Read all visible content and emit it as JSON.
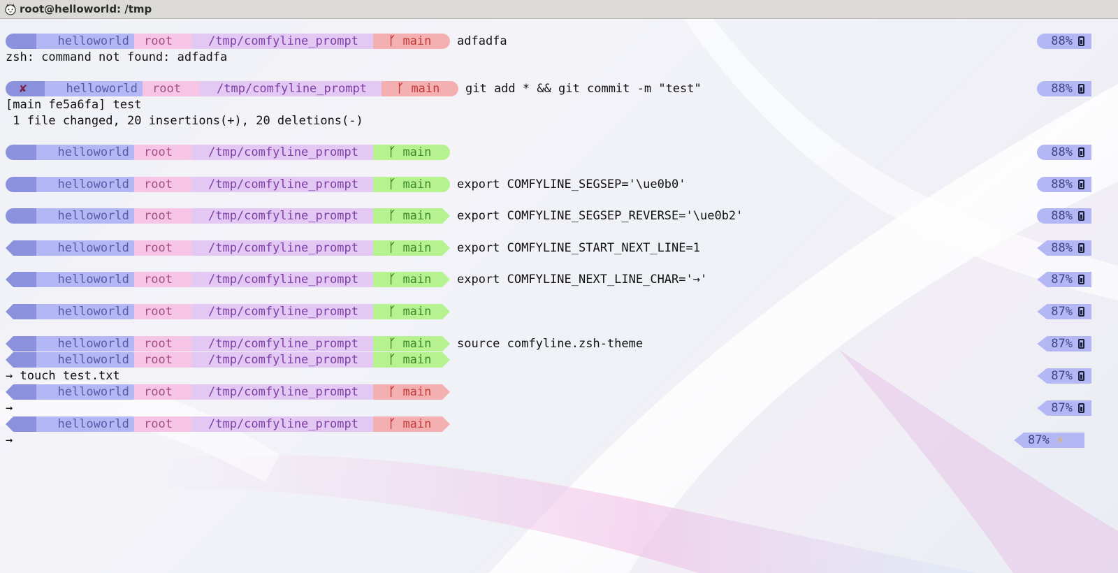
{
  "window": {
    "title": "root@helloworld: /tmp"
  },
  "prompt": {
    "host": "helloworld",
    "user": "root",
    "path": "/tmp/comfyline_prompt",
    "branch": "main",
    "error_mark": "✘",
    "branch_icon": "git-branch-icon"
  },
  "colors": {
    "status_bg": "#8b91dc",
    "host_bg": "#b3b8f4",
    "user_bg": "#f6c4e5",
    "path_bg": "#e2c8f2",
    "git_dirty_bg": "#f4b0b0",
    "git_clean_bg": "#b6f290",
    "battery_bg": "#b3b8f4"
  },
  "lines": [
    {
      "kind": "prompt",
      "style": "rounded",
      "git": "dirty",
      "cmd": "adfadfa",
      "batt": "88%",
      "power": "battery"
    },
    {
      "kind": "output",
      "text": "zsh: command not found: adfadfa"
    },
    {
      "kind": "prompt",
      "style": "rounded",
      "git": "dirty",
      "error": true,
      "cmd": "git add * && git commit -m \"test\"",
      "batt": "88%",
      "power": "battery"
    },
    {
      "kind": "output",
      "text": "[main fe5a6fa] test"
    },
    {
      "kind": "output",
      "text": " 1 file changed, 20 insertions(+), 20 deletions(-)"
    },
    {
      "kind": "prompt",
      "style": "rounded",
      "git": "clean",
      "cmd": "",
      "batt": "88%",
      "power": "battery"
    },
    {
      "kind": "prompt",
      "style": "rounded",
      "git": "clean",
      "cmd": "export COMFYLINE_SEGSEP='\\ue0b0'",
      "batt": "88%",
      "power": "battery"
    },
    {
      "kind": "prompt",
      "style": "rounded-arrow",
      "git": "clean",
      "cmd": "export COMFYLINE_SEGSEP_REVERSE='\\ue0b2'",
      "batt": "88%",
      "power": "battery"
    },
    {
      "kind": "prompt",
      "style": "arrow",
      "git": "clean",
      "cmd": "export COMFYLINE_START_NEXT_LINE=1",
      "batt": "88%",
      "power": "battery",
      "batt_arrow": true
    },
    {
      "kind": "prompt",
      "style": "arrow",
      "git": "clean",
      "cmd": "export COMFYLINE_NEXT_LINE_CHAR='→'",
      "batt": "87%",
      "power": "battery",
      "batt_arrow": true
    },
    {
      "kind": "prompt",
      "style": "arrow",
      "git": "clean",
      "cmd": "",
      "batt": "87%",
      "power": "battery",
      "batt_arrow": true
    },
    {
      "kind": "prompt",
      "style": "arrow",
      "git": "clean",
      "cmd": "source comfyline.zsh-theme",
      "batt": "87%",
      "power": "battery",
      "batt_arrow": true
    },
    {
      "kind": "prompt",
      "style": "arrow",
      "git": "clean",
      "cmd": ""
    },
    {
      "kind": "output",
      "text": "→ touch test.txt",
      "batt": "87%",
      "power": "battery",
      "batt_arrow": true
    },
    {
      "kind": "prompt",
      "style": "arrow",
      "git": "dirty",
      "cmd": ""
    },
    {
      "kind": "output",
      "text": "→",
      "batt": "87%",
      "power": "battery",
      "batt_arrow": true
    },
    {
      "kind": "prompt",
      "style": "arrow",
      "git": "dirty",
      "cmd": ""
    },
    {
      "kind": "output",
      "text": "→",
      "batt": "87%",
      "power": "charging",
      "batt_arrow": true
    }
  ]
}
